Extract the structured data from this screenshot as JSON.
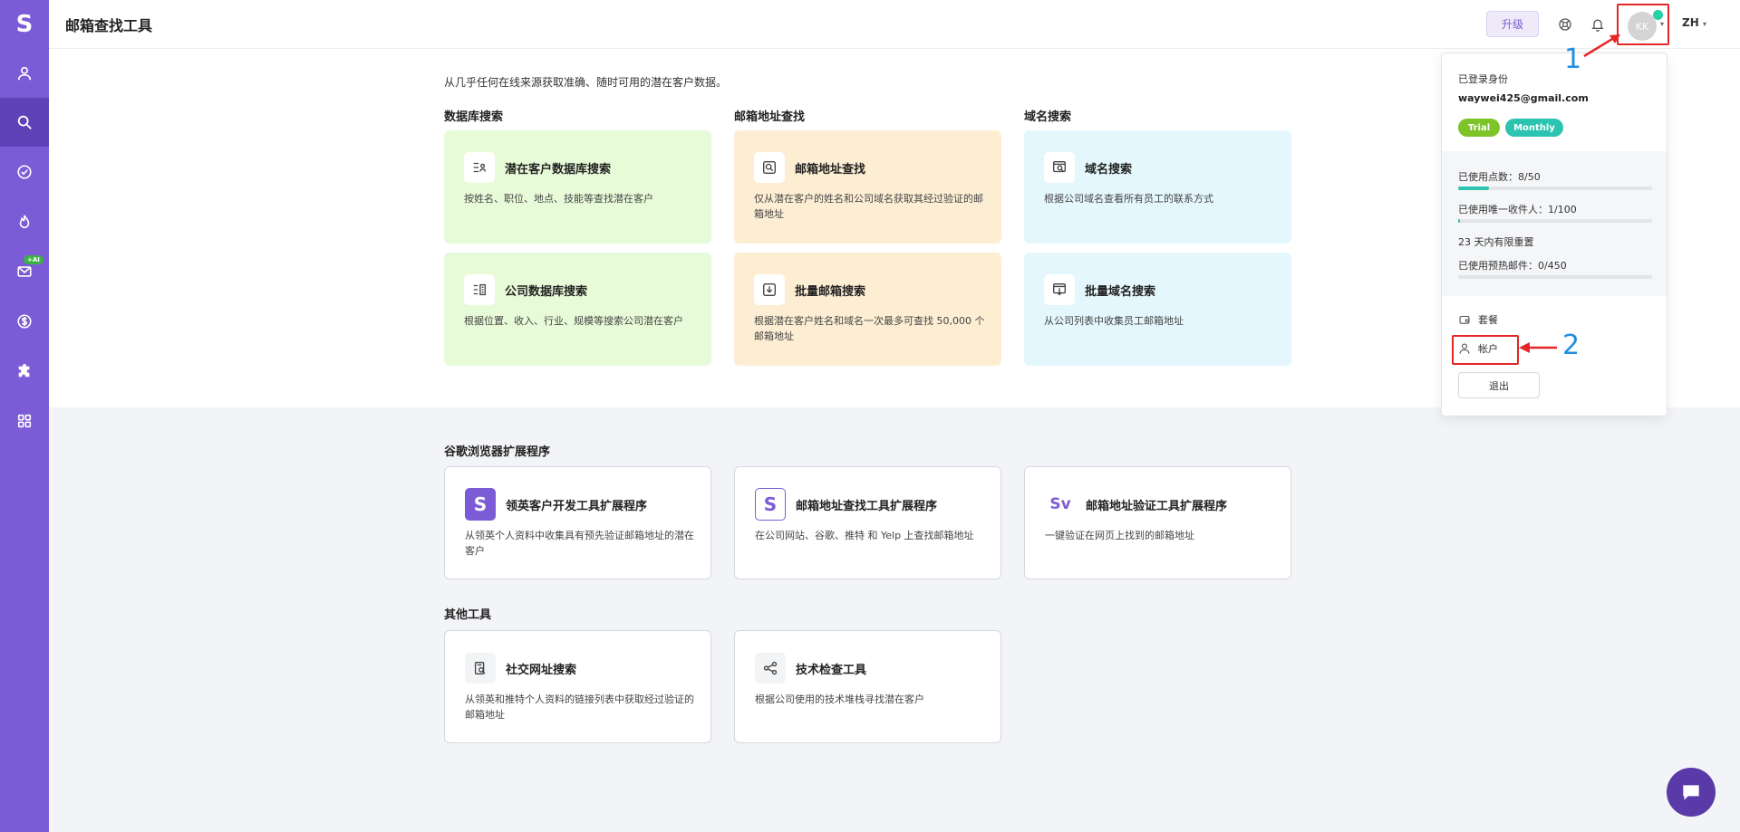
{
  "app": {
    "logo_letter": "S",
    "page_title": "邮箱查找工具"
  },
  "header": {
    "upgrade_label": "升级",
    "avatar_initials": "KK",
    "language": "ZH",
    "icons": [
      "support-icon",
      "bell-icon"
    ]
  },
  "sidebar": {
    "items": [
      {
        "icon": "user-icon"
      },
      {
        "icon": "search-icon",
        "active": true
      },
      {
        "icon": "check-circle-icon"
      },
      {
        "icon": "flame-icon"
      },
      {
        "icon": "mail-icon",
        "badge": "+AI"
      },
      {
        "icon": "dollar-icon"
      },
      {
        "icon": "puzzle-icon"
      },
      {
        "icon": "apps-grid-icon"
      }
    ]
  },
  "intro": "从几乎任何在线来源获取准确、随时可用的潜在客户数据。",
  "columns": [
    {
      "title": "数据库搜索"
    },
    {
      "title": "邮箱地址查找"
    },
    {
      "title": "域名搜索"
    }
  ],
  "tools": [
    {
      "title": "潜在客户数据库搜索",
      "desc": "按姓名、职位、地点、技能等查找潜在客户",
      "color": "green"
    },
    {
      "title": "邮箱地址查找",
      "desc": "仅从潜在客户的姓名和公司域名获取其经过验证的邮箱地址",
      "color": "orange"
    },
    {
      "title": "域名搜索",
      "desc": "根据公司域名查看所有员工的联系方式",
      "color": "blue"
    },
    {
      "title": "公司数据库搜索",
      "desc": "根据位置、收入、行业、规模等搜索公司潜在客户",
      "color": "green"
    },
    {
      "title": "批量邮箱搜索",
      "desc": "根据潜在客户姓名和域名一次最多可查找 50,000 个邮箱地址",
      "color": "orange"
    },
    {
      "title": "批量域名搜索",
      "desc": "从公司列表中收集员工邮箱地址",
      "color": "blue"
    }
  ],
  "extensions": {
    "title": "谷歌浏览器扩展程序",
    "items": [
      {
        "title": "领英客户开发工具扩展程序",
        "desc": "从领英个人资料中收集具有预先验证邮箱地址的潜在客户",
        "logo": "S"
      },
      {
        "title": "邮箱地址查找工具扩展程序",
        "desc": "在公司网站、谷歌、推特 和 Yelp 上查找邮箱地址",
        "logo": "S"
      },
      {
        "title": "邮箱地址验证工具扩展程序",
        "desc": "一键验证在网页上找到的邮箱地址",
        "logo": "Sv"
      }
    ]
  },
  "other_tools": {
    "title": "其他工具",
    "items": [
      {
        "title": "社交网址搜索",
        "desc": "从领英和推特个人资料的链接列表中获取经过验证的邮箱地址"
      },
      {
        "title": "技术检查工具",
        "desc": "根据公司使用的技术堆栈寻找潜在客户"
      }
    ]
  },
  "account_menu": {
    "logged_in_label": "已登录身份",
    "email": "waywei425@gmail.com",
    "plans": [
      "Trial",
      "Monthly"
    ],
    "usage": [
      {
        "label": "已使用点数：",
        "value": "8/50",
        "fraction": 0.16
      },
      {
        "label": "已使用唯一收件人：",
        "value": "1/100",
        "fraction": 0.01
      },
      {
        "label": "已使用预热邮件：",
        "value": "0/450",
        "fraction": 0.0
      }
    ],
    "reset_note": "23 天内有限重置",
    "menu": [
      {
        "label": "套餐",
        "icon": "wallet-icon"
      },
      {
        "label": "帐户",
        "icon": "user-icon"
      }
    ],
    "logout_label": "退出"
  },
  "annotations": [
    "1",
    "2"
  ],
  "colors": {
    "sidebar": "#7b5cd6",
    "sidebar_active": "#5f42b8",
    "trial": "#7cc427",
    "monthly": "#2cc3b0",
    "highlight": "#e32626",
    "annotation": "#1e8fe1"
  }
}
